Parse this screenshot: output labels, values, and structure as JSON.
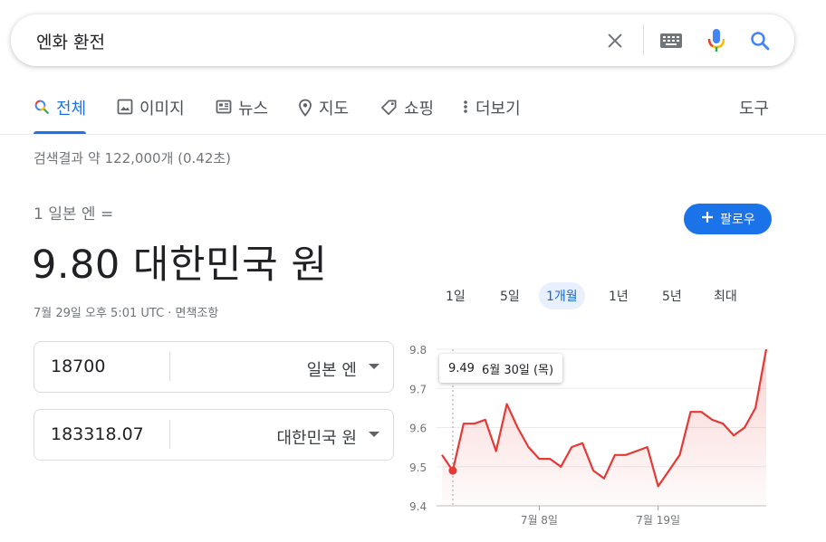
{
  "search": {
    "query": "엔화 환전"
  },
  "tabs": [
    {
      "label": "전체",
      "icon": "search-icon",
      "active": true
    },
    {
      "label": "이미지",
      "icon": "image-icon",
      "active": false
    },
    {
      "label": "뉴스",
      "icon": "news-icon",
      "active": false
    },
    {
      "label": "지도",
      "icon": "location-pin-icon",
      "active": false
    },
    {
      "label": "쇼핑",
      "icon": "tag-icon",
      "active": false
    },
    {
      "label": "더보기",
      "icon": "more-vert-icon",
      "active": false
    }
  ],
  "tools_label": "도구",
  "result_stats": "검색결과 약 122,000개 (0.42초)",
  "converter": {
    "from_label": "1 일본 엔 =",
    "to_value": "9.80 대한민국 원",
    "timestamp": "7월 29일 오후 5:01 UTC · 면책조항",
    "follow_label": "팔로우",
    "inputs": [
      {
        "amount": "18700",
        "currency": "일본 엔"
      },
      {
        "amount": "183318.07",
        "currency": "대한민국 원"
      }
    ]
  },
  "ranges": [
    "1일",
    "5일",
    "1개월",
    "1년",
    "5년",
    "최대"
  ],
  "active_range": "1개월",
  "tooltip": {
    "value": "9.49",
    "date": "6월 30일 (목)"
  },
  "colors": {
    "accent": "#1a73e8",
    "line": "#e53935"
  },
  "chart_data": {
    "type": "area",
    "x": [
      "6월 29일",
      "6월 30일",
      "7월 1일",
      "7월 2일",
      "7월 3일",
      "7월 4일",
      "7월 5일",
      "7월 6일",
      "7월 7일",
      "7월 8일",
      "7월 9일",
      "7월 10일",
      "7월 11일",
      "7월 12일",
      "7월 13일",
      "7월 14일",
      "7월 15일",
      "7월 16일",
      "7월 17일",
      "7월 18일",
      "7월 19일",
      "7월 20일",
      "7월 21일",
      "7월 22일",
      "7월 23일",
      "7월 24일",
      "7월 25일",
      "7월 26일",
      "7월 27일",
      "7월 28일",
      "7월 29일"
    ],
    "y": [
      9.53,
      9.49,
      9.61,
      9.61,
      9.62,
      9.54,
      9.66,
      9.6,
      9.55,
      9.52,
      9.52,
      9.5,
      9.55,
      9.56,
      9.49,
      9.47,
      9.53,
      9.53,
      9.54,
      9.55,
      9.45,
      9.49,
      9.53,
      9.64,
      9.64,
      9.62,
      9.61,
      9.58,
      9.6,
      9.65,
      9.8
    ],
    "yticks": [
      9.4,
      9.5,
      9.6,
      9.7,
      9.8
    ],
    "ylim": [
      9.4,
      9.8
    ],
    "xticks": [
      "7월 8일",
      "7월 19일"
    ],
    "highlight": "6월 30일"
  }
}
